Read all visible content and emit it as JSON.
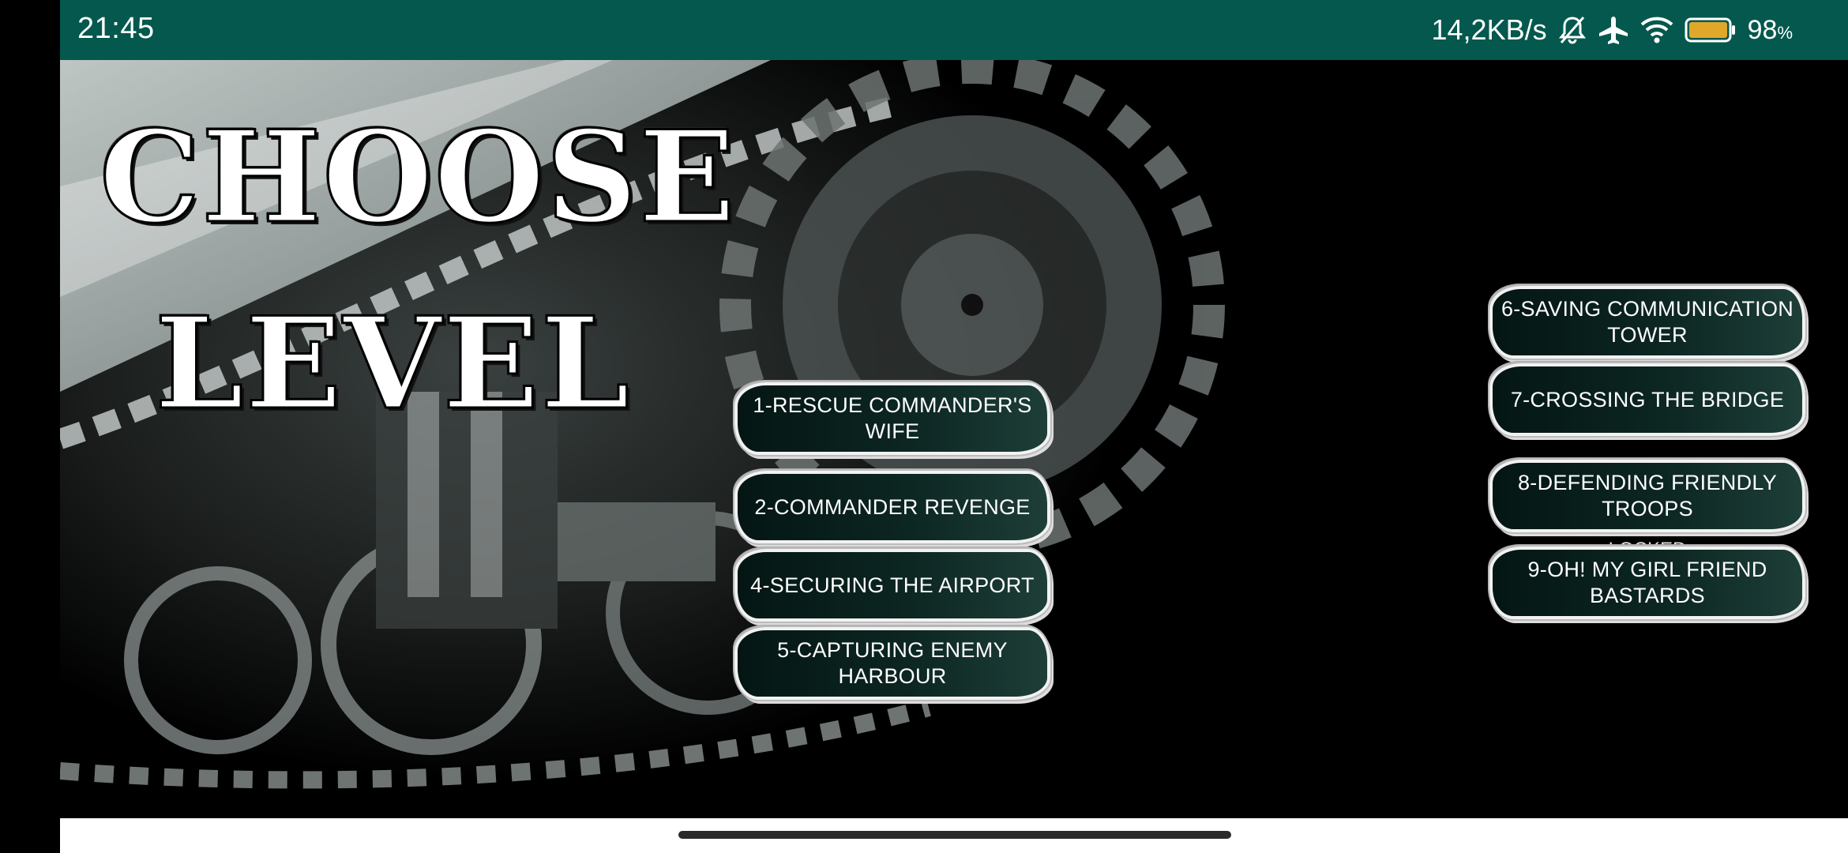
{
  "status_bar": {
    "time": "21:45",
    "net_speed": "14,2KB/s",
    "battery_percent": "98",
    "battery_unit": "%",
    "icons": [
      "bell-off-icon",
      "airplane-icon",
      "wifi-icon",
      "battery-icon"
    ],
    "color": "#05584d"
  },
  "screen": {
    "title_line1": "CHOOSE",
    "title_line2": "LEVEL"
  },
  "levels": [
    {
      "label": "1-RESCUE COMMANDER'S WIFE"
    },
    {
      "label": "2-COMMANDER REVENGE"
    },
    {
      "label": "4-SECURING THE AIRPORT"
    },
    {
      "label": "5-CAPTURING ENEMY HARBOUR"
    },
    {
      "label": "6-SAVING COMMUNICATION TOWER"
    },
    {
      "label": "7-CROSSING THE BRIDGE"
    },
    {
      "label": "8-DEFENDING FRIENDLY TROOPS"
    },
    {
      "label": "9-OH! MY GIRL FRIEND BASTARDS"
    }
  ],
  "hidden_label": "LOCKED",
  "colors": {
    "button_dark": "#041614",
    "button_light": "#1e3e38"
  }
}
